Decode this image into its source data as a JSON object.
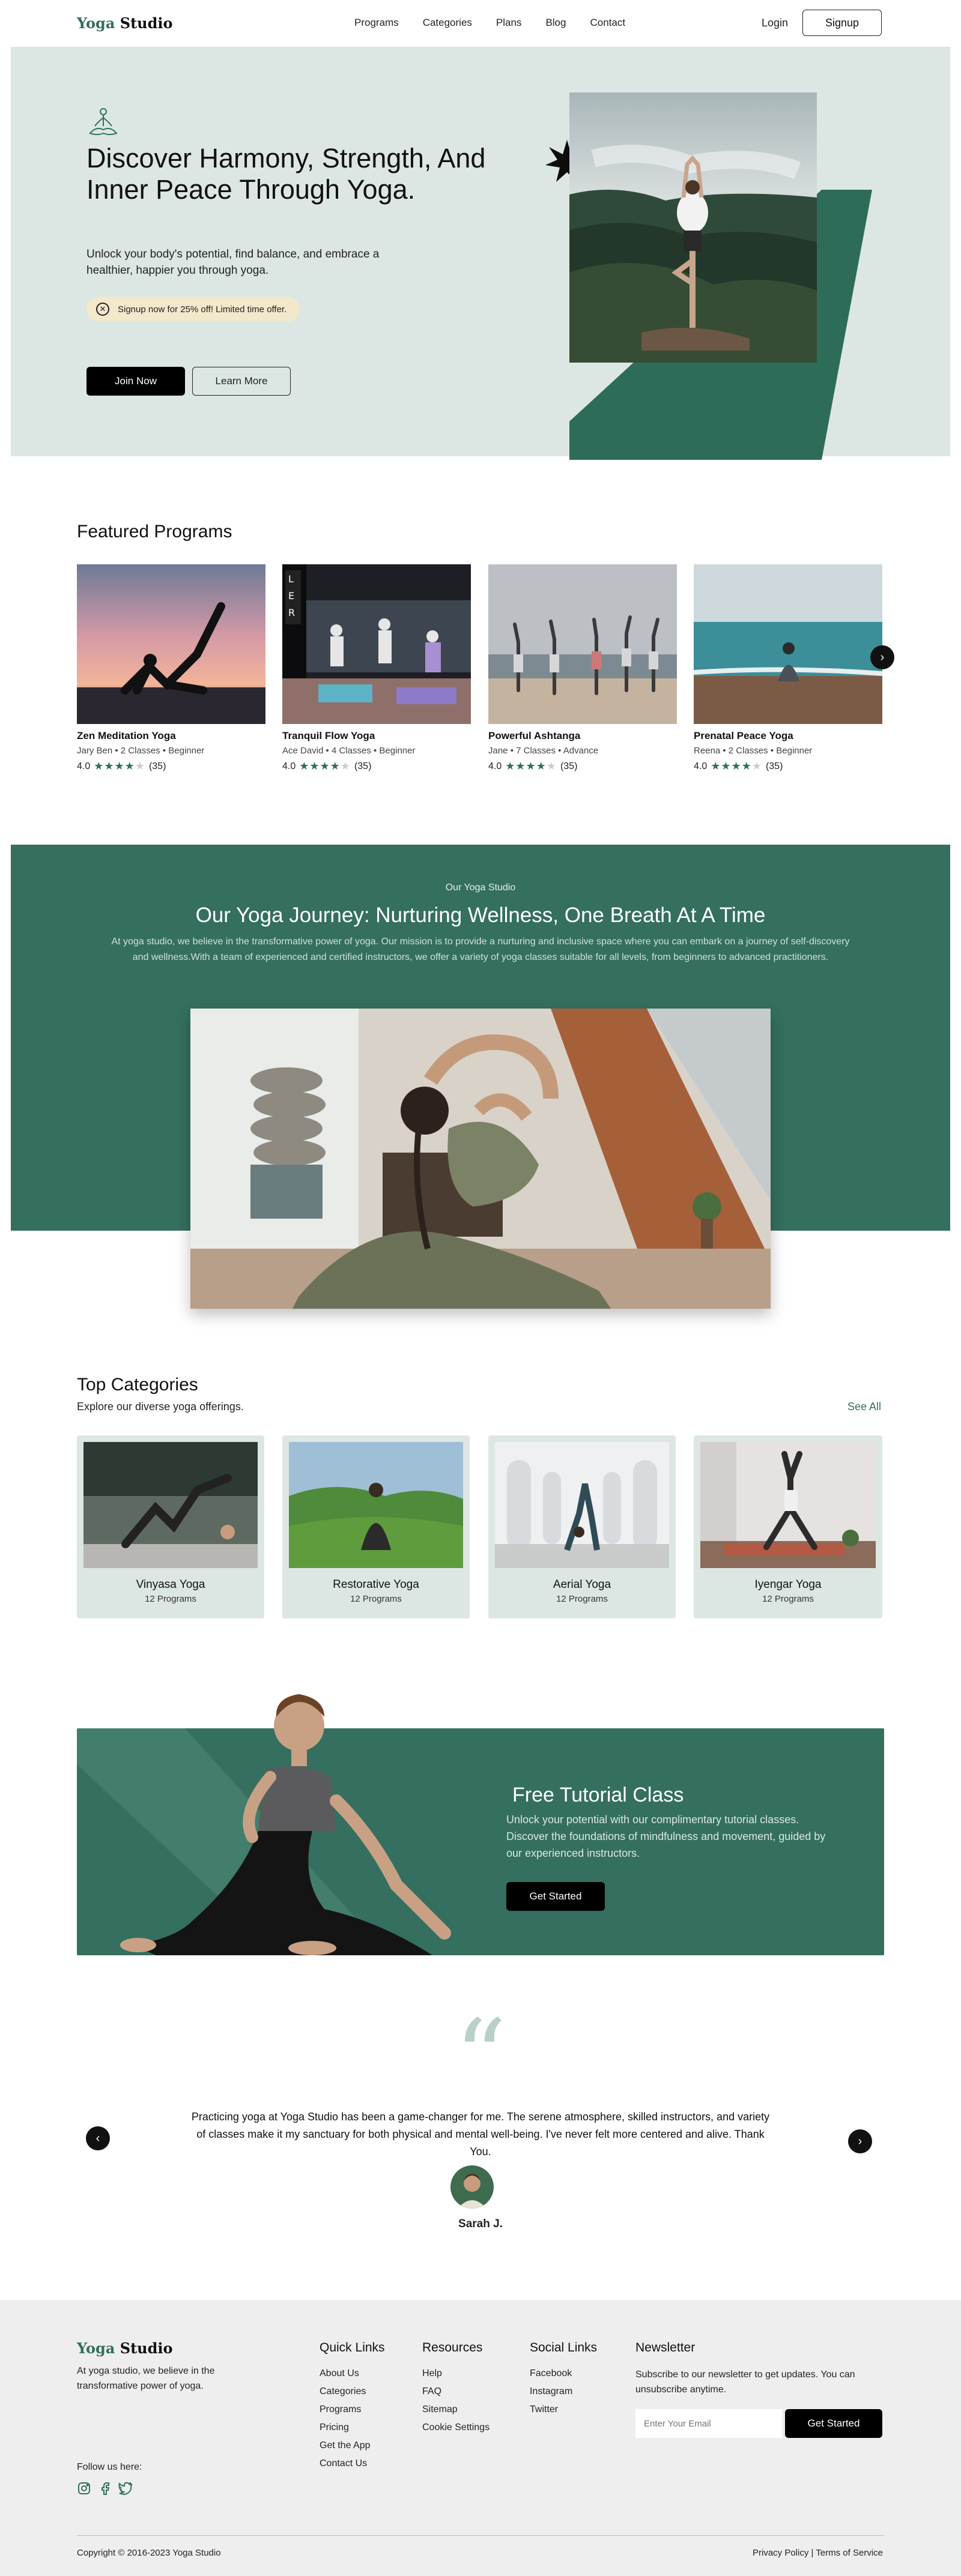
{
  "nav": {
    "logo_accent": "Yoga",
    "logo_rest": "Studio",
    "links": [
      "Programs",
      "Categories",
      "Plans",
      "Blog",
      "Contact"
    ],
    "login": "Login",
    "signup": "Signup"
  },
  "hero": {
    "title": "Discover Harmony, Strength, And Inner Peace Through Yoga.",
    "subtitle": "Unlock your body's potential, find balance, and embrace a healthier, happier you through yoga.",
    "promo": "Signup now for 25% off! Limited time offer.",
    "join": "Join Now",
    "learn": "Learn More"
  },
  "featured": {
    "heading": "Featured Programs",
    "cards": [
      {
        "title": "Zen Meditation Yoga",
        "instructor": "Jary Ben",
        "classes": "2 Classes",
        "level": "Beginner",
        "rating": "4.0",
        "reviews": "(35)"
      },
      {
        "title": "Tranquil Flow Yoga",
        "instructor": "Ace David",
        "classes": "4 Classes",
        "level": "Beginner",
        "rating": "4.0",
        "reviews": "(35)"
      },
      {
        "title": "Powerful Ashtanga",
        "instructor": "Jane",
        "classes": "7 Classes",
        "level": "Advance",
        "rating": "4.0",
        "reviews": "(35)"
      },
      {
        "title": "Prenatal Peace Yoga",
        "instructor": "Reena",
        "classes": "2 Classes",
        "level": "Beginner",
        "rating": "4.0",
        "reviews": "(35)"
      }
    ],
    "star_rating": 4,
    "next_icon": "chevron-right-icon"
  },
  "journey": {
    "eyebrow": "Our Yoga Studio",
    "title": "Our Yoga Journey: Nurturing Wellness, One Breath At A Time",
    "body": "At yoga studio, we believe in the transformative power of yoga. Our mission is to provide a nurturing and inclusive space where you can embark on a journey of self-discovery and wellness.With a team of experienced and certified instructors, we offer a variety of yoga classes suitable for all levels, from beginners to advanced practitioners."
  },
  "categories": {
    "heading": "Top Categories",
    "subheading": "Explore our diverse yoga offerings.",
    "see_all": "See All",
    "items": [
      {
        "name": "Vinyasa Yoga",
        "count": "12 Programs"
      },
      {
        "name": "Restorative Yoga",
        "count": "12 Programs"
      },
      {
        "name": "Aerial Yoga",
        "count": "12 Programs"
      },
      {
        "name": "Iyengar Yoga",
        "count": "12 Programs"
      }
    ]
  },
  "tutorial": {
    "title": "Free Tutorial Class",
    "body": "Unlock your potential with our complimentary tutorial classes. Discover the foundations of mindfulness and movement, guided by our experienced instructors.",
    "button": "Get Started"
  },
  "testimonial": {
    "quote": "Practicing yoga at Yoga Studio has been a game-changer for me. The serene atmosphere, skilled instructors, and variety of classes make it my sanctuary for both physical and mental well-being. I've never felt more centered and alive. Thank You.",
    "author": "Sarah J."
  },
  "footer": {
    "logo_accent": "Yoga",
    "logo_rest": "Studio",
    "tagline": "At yoga studio, we believe in the transformative power of yoga.",
    "follow": "Follow us here:",
    "quick_links": {
      "heading": "Quick Links",
      "items": [
        "About Us",
        "Categories",
        "Programs",
        "Pricing",
        "Get the App",
        "Contact Us"
      ]
    },
    "resources": {
      "heading": "Resources",
      "items": [
        "Help",
        "FAQ",
        "Sitemap",
        "Cookie Settings"
      ]
    },
    "social": {
      "heading": "Social Links",
      "items": [
        "Facebook",
        "Instagram",
        "Twitter"
      ]
    },
    "newsletter": {
      "heading": "Newsletter",
      "text": "Subscribe to our newsletter to get updates. You can unsubscribe anytime.",
      "placeholder": "Enter Your Email",
      "button": "Get Started"
    },
    "copyright": "Copyright © 2016-2023 Yoga Studio",
    "legal": "Privacy Policy | Terms of Service"
  },
  "colors": {
    "accent": "#346f5f",
    "hero_bg": "#dce7e3",
    "promo_bg": "#f3e8cc"
  }
}
